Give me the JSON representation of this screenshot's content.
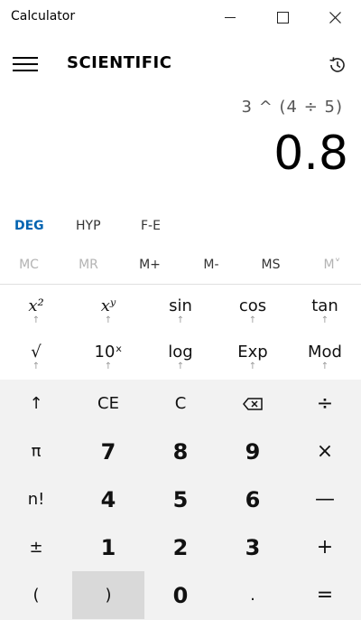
{
  "window": {
    "title": "Calculator",
    "minimize": "—",
    "maximize": "☐",
    "close": "✕"
  },
  "header": {
    "mode": "SCIENTIFIC"
  },
  "display": {
    "expression": "3 ^ (4 ÷ 5)",
    "result": "0.8"
  },
  "mode_row": {
    "angle": "DEG",
    "hyp": "HYP",
    "fe": "F-E",
    "active_color": "#0063b1"
  },
  "memory": [
    "MC",
    "MR",
    "M+",
    "M-",
    "MS",
    "M˅"
  ],
  "scientific": [
    {
      "label": "x²",
      "name": "square"
    },
    {
      "label": "xʸ",
      "name": "power"
    },
    {
      "label": "sin",
      "name": "sin"
    },
    {
      "label": "cos",
      "name": "cos"
    },
    {
      "label": "tan",
      "name": "tan"
    },
    {
      "label": "√",
      "name": "sqrt"
    },
    {
      "label": "10ˣ",
      "name": "ten-power"
    },
    {
      "label": "log",
      "name": "log"
    },
    {
      "label": "Exp",
      "name": "exp"
    },
    {
      "label": "Mod",
      "name": "mod"
    }
  ],
  "shift_arrow": "↑",
  "keypad": [
    [
      "↑",
      "CE",
      "C",
      "⌫",
      "÷"
    ],
    [
      "π",
      "7",
      "8",
      "9",
      "×"
    ],
    [
      "n!",
      "4",
      "5",
      "6",
      "—"
    ],
    [
      "±",
      "1",
      "2",
      "3",
      "+"
    ],
    [
      "(",
      ")",
      "0",
      ".",
      "="
    ]
  ]
}
